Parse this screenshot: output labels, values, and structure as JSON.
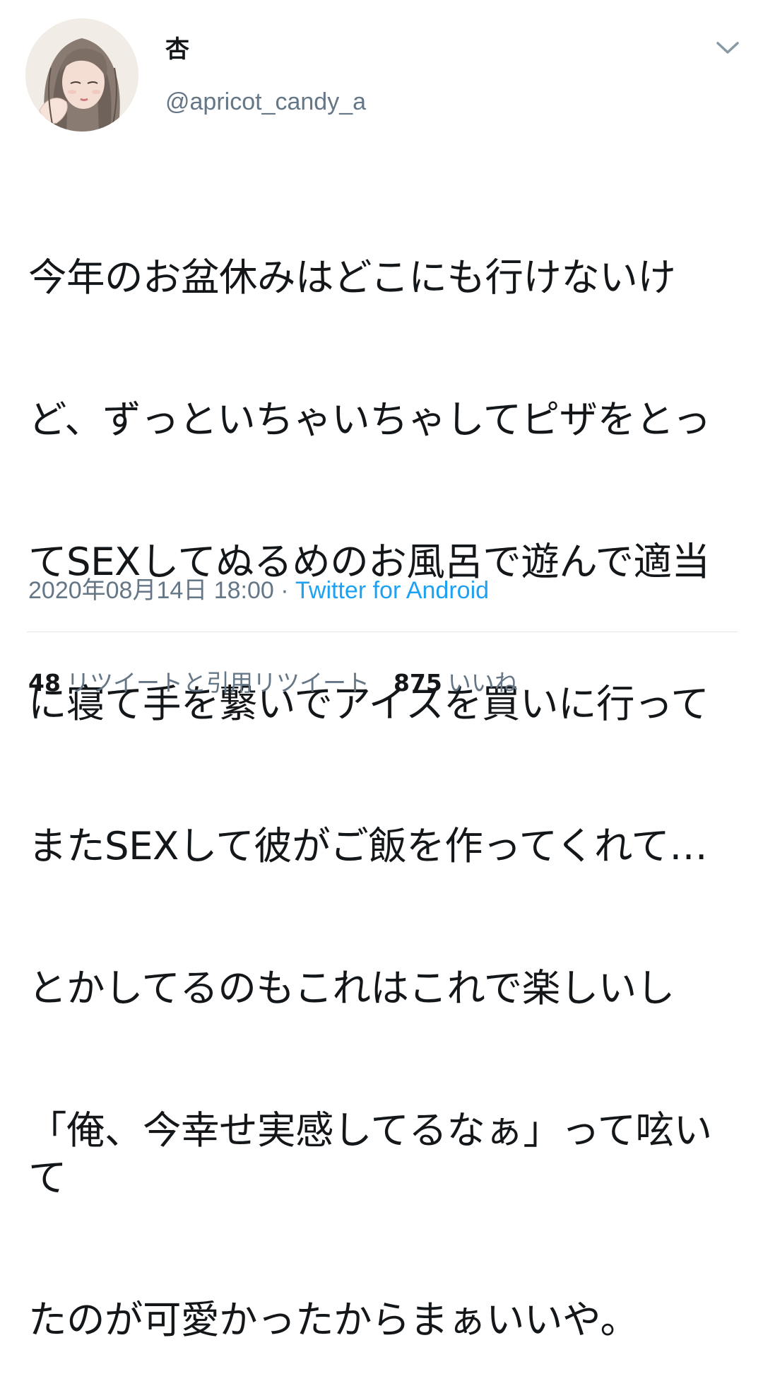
{
  "author": {
    "display_name": "杏",
    "handle": "@apricot_candy_a",
    "avatar_icon": "avatar-illustration"
  },
  "menu": {
    "icon": "chevron-down-icon"
  },
  "tweet": {
    "text": "今年のお盆休みはどこにも行けないけど、ずっといちゃいちゃしてピザをとってSEXしてぬるめのお風呂で遊んで適当に寝て手を繋いでアイスを買いに行ってまたSEXして彼がご飯を作ってくれて…とかしてるのもこれはこれで楽しいし「俺、今幸せ実感してるなぁ」って呟いてたのが可愛かったからまぁいいや。",
    "lines": [
      "今年のお盆休みはどこにも行けないけ",
      "ど、ずっといちゃいちゃしてピザをとっ",
      "てSEXしてぬるめのお風呂で遊んで適当",
      "に寝て手を繋いでアイスを買いに行って",
      "またSEXして彼がご飯を作ってくれて…",
      "とかしてるのもこれはこれで楽しいし",
      "「俺、今幸せ実感してるなぁ」って呟いて",
      "たのが可愛かったからまぁいいや。"
    ],
    "timestamp": "2020年08月14日 18:00",
    "separator": " · ",
    "source": "Twitter for Android"
  },
  "stats": {
    "retweets_count": "48",
    "retweets_label": "リツイートと引用リツイート",
    "likes_count": "875",
    "likes_label": "いいね"
  },
  "colors": {
    "text": "#14171a",
    "secondary": "#657786",
    "link": "#1da1f2",
    "divider": "#e1e8ed"
  }
}
